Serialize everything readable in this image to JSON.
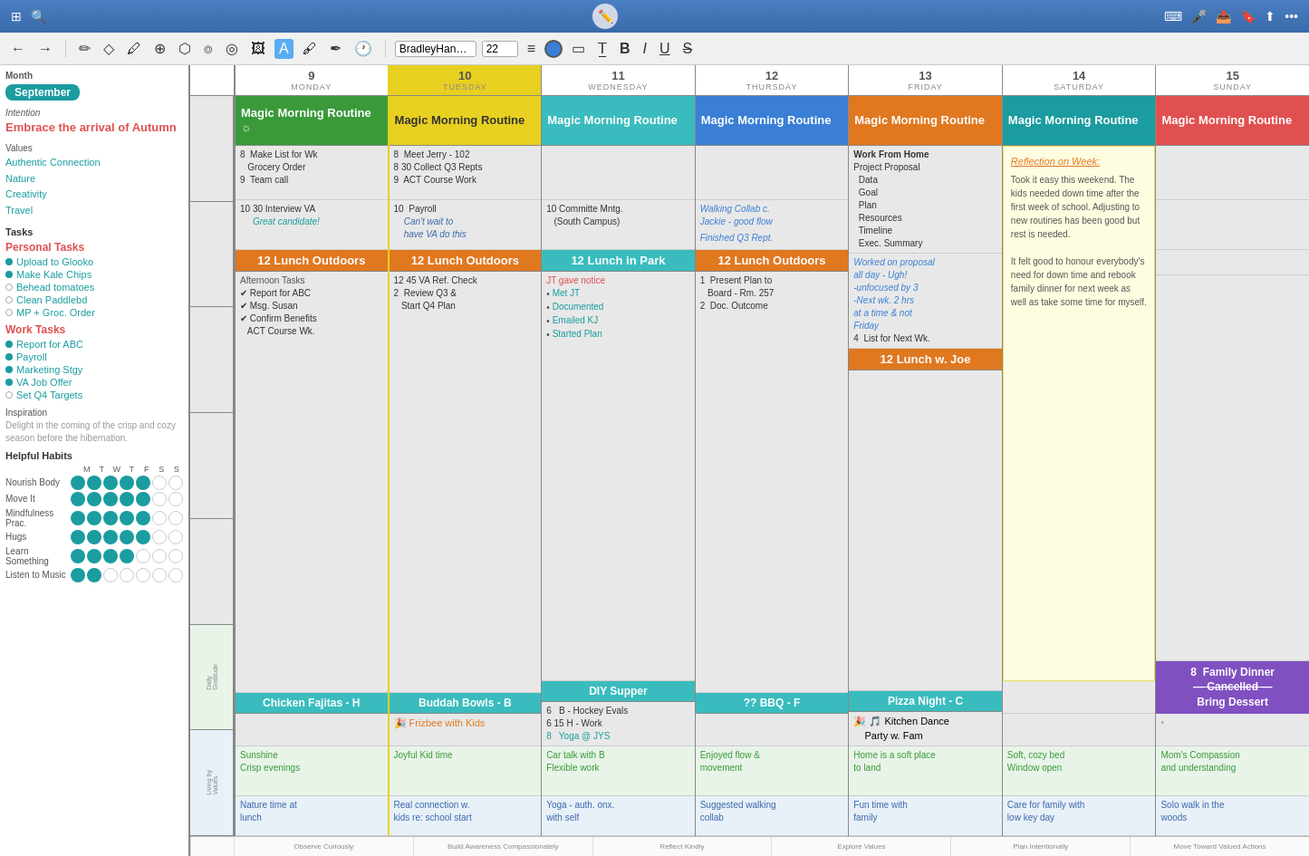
{
  "topbar": {
    "title": "BradleyHandl...",
    "font_size": "22"
  },
  "header": {
    "month_label": "Month",
    "month": "September",
    "intention_label": "Intention",
    "intention": "Embrace the arrival of Autumn",
    "values_label": "Values",
    "values": [
      "Authentic Connection",
      "Nature",
      "Creativity",
      "Travel"
    ],
    "tasks_label": "Tasks",
    "personal_tasks_label": "Personal Tasks",
    "personal_tasks": [
      {
        "label": "Upload to Glooko",
        "done": true
      },
      {
        "label": "Make Kale Chips",
        "done": true
      },
      {
        "label": "Behead tomatoes",
        "done": false
      },
      {
        "label": "Clean Paddlebd",
        "done": false
      },
      {
        "label": "MP + Groc. Order",
        "done": false
      }
    ],
    "work_tasks_label": "Work Tasks",
    "work_tasks": [
      {
        "label": "Report for ABC",
        "done": true
      },
      {
        "label": "Payroll",
        "done": true
      },
      {
        "label": "Marketing Stgy",
        "done": true
      },
      {
        "label": "VA Job Offer",
        "done": true
      },
      {
        "label": "Set Q4 Targets",
        "done": false
      }
    ],
    "inspiration_label": "Inspiration",
    "inspiration_text": "Delight in the coming of the crisp and cozy season before the hibernation.",
    "habits_label": "Helpful Habits",
    "habit_days": [
      "M",
      "T",
      "W",
      "T",
      "F",
      "S",
      "S"
    ],
    "habits": [
      {
        "name": "Nourish Body",
        "filled": [
          true,
          true,
          true,
          true,
          true,
          false,
          false
        ]
      },
      {
        "name": "Move It",
        "filled": [
          true,
          true,
          true,
          true,
          true,
          false,
          false
        ]
      },
      {
        "name": "Mindfulness Prac.",
        "filled": [
          true,
          true,
          true,
          true,
          true,
          false,
          false
        ]
      },
      {
        "name": "Hugs",
        "filled": [
          true,
          true,
          true,
          true,
          true,
          false,
          false
        ]
      },
      {
        "name": "Learn Something",
        "filled": [
          true,
          true,
          true,
          true,
          false,
          false,
          false
        ]
      },
      {
        "name": "Listen to Music",
        "filled": [
          true,
          true,
          false,
          false,
          false,
          false,
          false
        ]
      }
    ]
  },
  "days": {
    "headers": [
      {
        "num": "9",
        "name": "MONDAY"
      },
      {
        "num": "10",
        "name": "TUESDAY"
      },
      {
        "num": "11",
        "name": "WEDNESDAY"
      },
      {
        "num": "12",
        "name": "THURSDAY"
      },
      {
        "num": "13",
        "name": "FRIDAY"
      },
      {
        "num": "14",
        "name": "SATURDAY"
      },
      {
        "num": "15",
        "name": "SUNDAY"
      }
    ],
    "morning_banners": [
      {
        "text": "Magic Morning Routine ☼",
        "bg": "#3a9a3a",
        "color": "white"
      },
      {
        "text": "Magic Morning Routine",
        "bg": "#e8d020",
        "color": "#333"
      },
      {
        "text": "Magic Morning Routine",
        "bg": "#3abcbe",
        "color": "white"
      },
      {
        "text": "Magic Morning Routine",
        "bg": "#3a7fd5",
        "color": "white"
      },
      {
        "text": "Magic Morning Routine",
        "bg": "#e07820",
        "color": "white"
      },
      {
        "text": "Magic Morning Routine",
        "bg": "#1a9ca0",
        "color": "white"
      },
      {
        "text": "Magic Morning Routine",
        "bg": "#e05050",
        "color": "white"
      }
    ],
    "col9": {
      "morning": "8  Make List for Wk\n   Grocery Order\n9  Team call",
      "midday": "10 30 Interview VA\n   Great candidate!",
      "lunch": "12 Lunch Outdoors",
      "lunch_bg": "#e07820",
      "afternoon": "Afternoon Tasks\n✔ Report for ABC\n✔ Msg. Susan\n✔ Confirm Benefits\n   ACT Course Wk.",
      "dinner": "Chicken Fajitas - H",
      "dinner_bg": "#3abcbe",
      "gratitude": "Sunshine\nCrisp evenings",
      "living": "Nature time at\nlunch"
    },
    "col10": {
      "morning": "8  Meet Jerry - 102\n8 30 Collect Q3 Repts\n9  ACT Course Work",
      "midday": "10  Payroll\n    Can't wait to\n    have VA do this",
      "lunch": "12 Lunch Outdoors",
      "lunch_bg": "#e07820",
      "afternoon": "12 45 VA Ref. Check\n2  Review Q3 &\n   Start Q4 Plan",
      "dinner": "Buddah Bowls - B",
      "dinner_bg": "#3abcbe",
      "evening": "🎉 Frizbee with Kids",
      "gratitude": "Joyful Kid time",
      "living": "Real connection w.\nkids re: school start"
    },
    "col11": {
      "morning": "",
      "midday": "10 Committe Mntg.\n   (South Campus)",
      "lunch": "12 Lunch in Park",
      "lunch_bg": "#3abcbe",
      "afternoon": "JT gave notice\n• Met JT\n• Documented\n• Emailed KJ\n• Started Plan",
      "dinner": "DIY Supper",
      "dinner_bg": "#3abcbe",
      "evening": "6  B - Hockey Evals\n6 15 H - Work\n8  Yoga @ JYS",
      "gratitude": "Car talk with B\nFlexible work",
      "living": "Yoga - auth. onx.\nwith self"
    },
    "col12": {
      "morning": "",
      "midday": "Walking Collab c.\nJackie - good flow\n\nFinished Q3 Rept.",
      "lunch": "12 Lunch Outdoors",
      "lunch_bg": "#e07820",
      "afternoon": "1  Present Plan to\n   Board - Rm. 257\n2  Doc. Outcome",
      "dinner": "?? BBQ - F",
      "dinner_bg": "#3abcbe",
      "gratitude": "Enjoyed flow &\nmovement",
      "living": "Suggested walking\ncollab"
    },
    "col13": {
      "morning": "Work From Home\nProject Proposal\n  Data\n  Goal\n  Plan\n  Resources\n  Timeline\n  Exec. Summary",
      "midday": "Worked on proposal\nall day - Ugh!\n-unfocused by 3\n-Next wk. 2 hrs\nat a time & not\nFriday\n4  List for Next Wk.",
      "lunch": "12 Lunch w. Joe",
      "lunch_bg": "#e07820",
      "afternoon": "",
      "dinner": "Pizza Night - C",
      "dinner_bg": "#3abcbe",
      "evening": "🎉 🎵 Kitchen Dance\nParty w. Fam",
      "gratitude": "Home is a soft place\nto land",
      "living": "Fun time with\nfamily"
    },
    "col14": {
      "sticky_title": "Reflection on Week:",
      "sticky_body": "Took it easy this weekend. The kids needed down time after the first week of school. Adjusting to new routines has been good but rest is needed.\n\nIt felt good to honour everybody's need for down time and rebook family dinner for next week as well as take some time for myself.",
      "dinner": "",
      "dinner_bg": "#3abcbe",
      "gratitude": "Soft, cozy bed\nWindow open",
      "living": "Care for family with\nlow key day"
    },
    "col15": {
      "morning": "",
      "midday": "",
      "dinner_special": "8  Family Dinner\n— Cancelled —\nBring Dessert",
      "gratitude": "Mom's Compassion\nand understanding",
      "living": "Solo walk in the\nwoods"
    }
  },
  "bottom_values": [
    "Observe Curiously",
    "Build Awareness Compassionately",
    "Reflect Kindly",
    "Explore Values",
    "Plan Intentionally",
    "Move Toward Valued Actions"
  ]
}
